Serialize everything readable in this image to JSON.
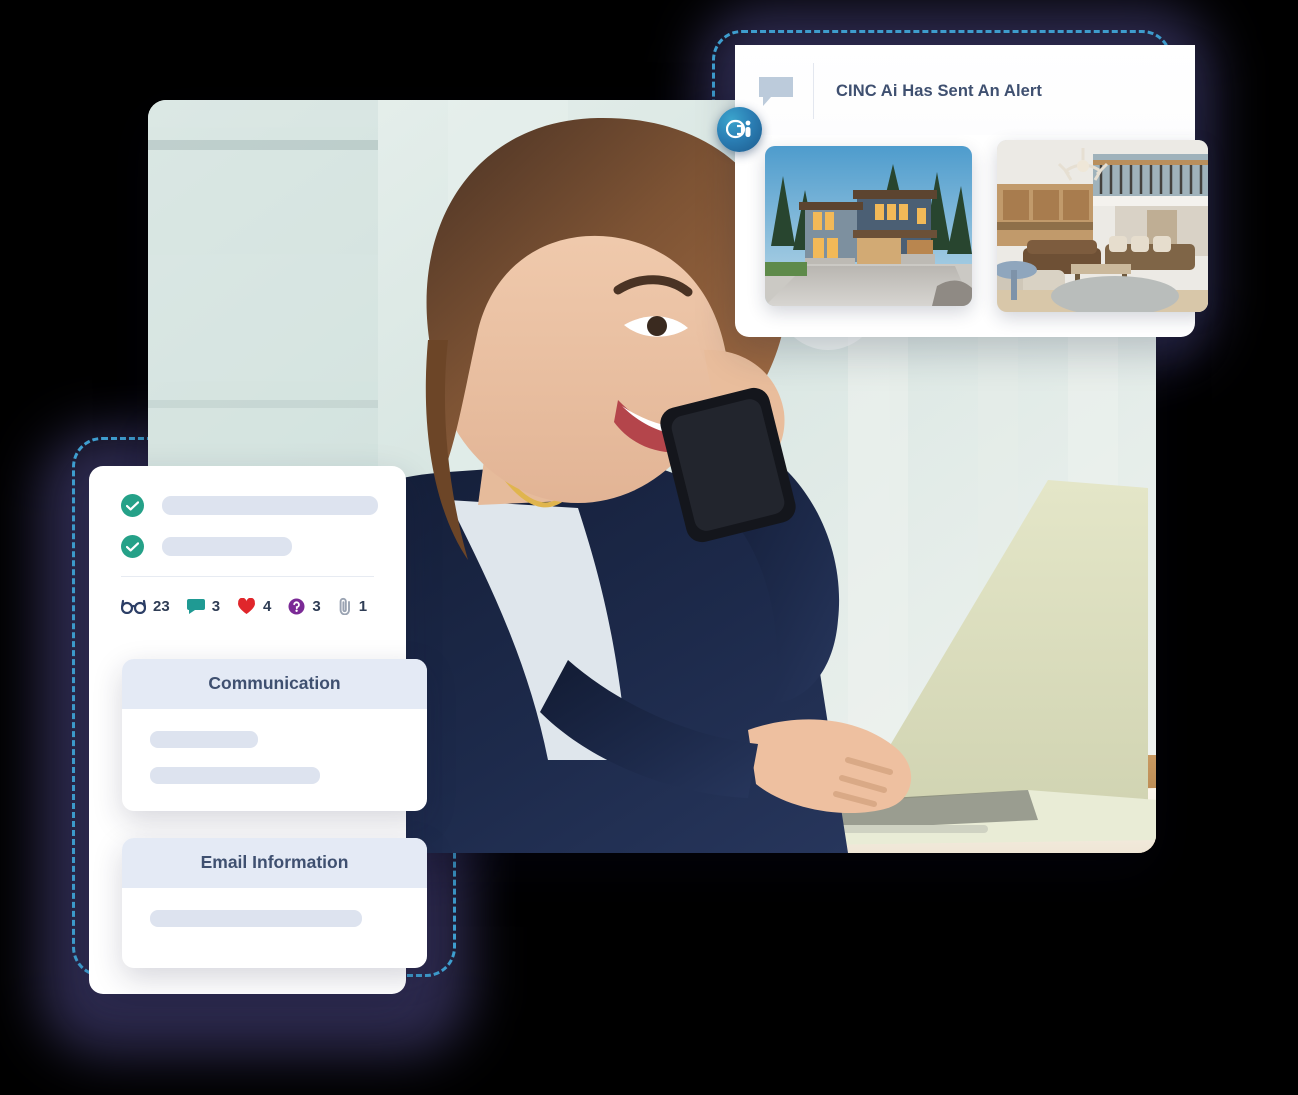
{
  "theme": {
    "backdrop": "#2d2a4e",
    "dashed_border": "#3f9fd0",
    "card_bg": "#ffffff",
    "skeleton": "#dde3ef",
    "header_bg": "#e4eaf5",
    "title_text": "#3f5070",
    "check_green": "#25a188",
    "heart_red": "#e0262b",
    "chat_teal": "#1f9a93",
    "question_purple": "#7b2a96",
    "glasses_navy": "#2c3e66",
    "paperclip_gray": "#9aa3b2",
    "ai_badge_blue": "#2b7fb5"
  },
  "alert_card": {
    "icon_name": "speech-bubble-icon",
    "title": "CINC Ai Has Sent An Alert",
    "subtitle_placeholder": "",
    "properties": [
      {
        "name": "property-photo-exterior",
        "alt": "Modern two-story blue home exterior with three-car garage and driveway"
      },
      {
        "name": "property-photo-interior",
        "alt": "Open-concept luxury living room with antler chandelier and loft railing"
      }
    ]
  },
  "ai_badge": {
    "name": "cinc-ai-badge",
    "label": "Ai"
  },
  "hero": {
    "name": "hero-photo",
    "alt": "Smiling businesswoman in navy blazer on a phone call while typing on a laptop"
  },
  "detail_card": {
    "checks": [
      {
        "name": "check-item-1",
        "state": "complete"
      },
      {
        "name": "check-item-2",
        "state": "complete"
      }
    ],
    "stats": [
      {
        "icon": "glasses-icon",
        "label": "views",
        "count": "23"
      },
      {
        "icon": "chat-icon",
        "label": "comments",
        "count": "3"
      },
      {
        "icon": "heart-icon",
        "label": "favorites",
        "count": "4"
      },
      {
        "icon": "question-icon",
        "label": "questions",
        "count": "3"
      },
      {
        "icon": "paperclip-icon",
        "label": "attachments",
        "count": "1"
      }
    ]
  },
  "sections": [
    {
      "name": "communication-card",
      "title": "Communication",
      "rows": 2
    },
    {
      "name": "email-information-card",
      "title": "Email Information",
      "rows": 1
    }
  ]
}
